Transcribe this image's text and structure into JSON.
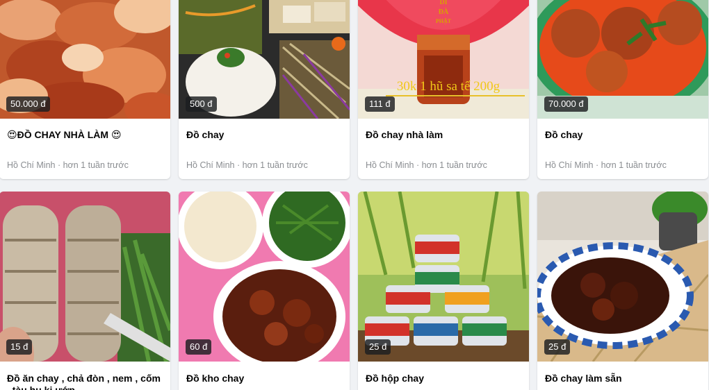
{
  "listings": [
    {
      "price": "50.000 đ",
      "title": "😍ĐỒ CHAY NHÀ LÀM 😍",
      "location": "Hồ Chí Minh",
      "time": "hơn 1 tuần trước"
    },
    {
      "price": "500 đ",
      "title": "Đồ chay",
      "location": "Hồ Chí Minh",
      "time": "hơn 1 tuần trước"
    },
    {
      "price": "111 đ",
      "title": "Đồ chay nhà làm",
      "location": "Hồ Chí Minh",
      "time": "hơn 1 tuần trước",
      "image_text": [
        "DI",
        "ĐÀ",
        "PHẬT",
        "30k 1 hũ sa tế 200g"
      ]
    },
    {
      "price": "70.000 đ",
      "title": "Đồ chay",
      "location": "Hồ Chí Minh",
      "time": "hơn 1 tuần trước"
    },
    {
      "price": "15 đ",
      "title": "Đồ ăn chay , chả đòn , nem , cốm , tàu hụ ki ướp"
    },
    {
      "price": "60 đ",
      "title": "Đồ kho chay"
    },
    {
      "price": "25 đ",
      "title": "Đồ hộp chay"
    },
    {
      "price": "25 đ",
      "title": "Đồ chay làm sẵn"
    }
  ],
  "meta_separator": " · ",
  "colors": {
    "background": "#f0f2f5",
    "card": "#ffffff",
    "title": "#050505",
    "meta": "#8a8d91",
    "price_tag": "#1c1e21"
  }
}
